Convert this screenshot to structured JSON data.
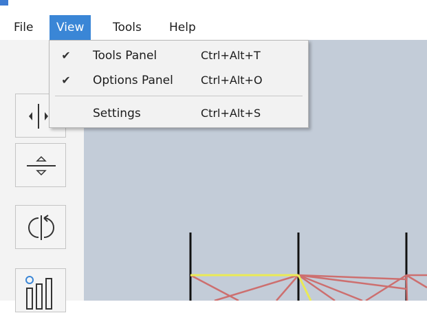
{
  "menubar": {
    "items": [
      {
        "label": "File"
      },
      {
        "label": "View"
      },
      {
        "label": "Tools"
      },
      {
        "label": "Help"
      }
    ]
  },
  "view_menu": {
    "items": [
      {
        "label": "Tools Panel",
        "shortcut": "Ctrl+Alt+T",
        "checked": true,
        "check_glyph": "✔"
      },
      {
        "label": "Options Panel",
        "shortcut": "Ctrl+Alt+O",
        "checked": true,
        "check_glyph": "✔"
      },
      {
        "label": "Settings",
        "shortcut": "Ctrl+Alt+S",
        "checked": false,
        "check_glyph": ""
      }
    ]
  },
  "sidebar": {
    "tools": [
      {
        "icon": "split-horizontal-icon"
      },
      {
        "icon": "split-vertical-icon"
      },
      {
        "icon": "rotate-icon"
      },
      {
        "icon": "chart-settings-icon"
      }
    ]
  },
  "colors": {
    "menu_highlight": "#3a86d6",
    "canvas_bg": "#c3ccd8",
    "post_color": "#111111",
    "highlight_line": "#eaea55",
    "link_line": "#cd6f6f"
  }
}
